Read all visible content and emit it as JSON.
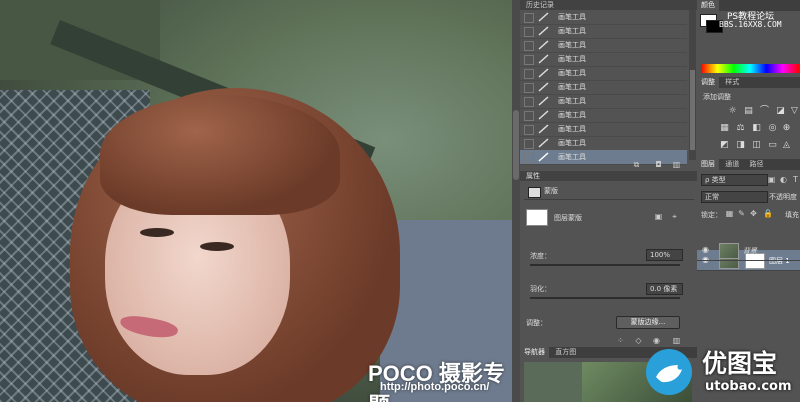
{
  "canvas": {
    "watermark_brand": "POCO 摄影专题",
    "watermark_url": "http://photo.poco.cn/"
  },
  "history_panel": {
    "title": "历史记录",
    "items": [
      "画笔工具",
      "画笔工具",
      "画笔工具",
      "画笔工具",
      "画笔工具",
      "画笔工具",
      "画笔工具",
      "画笔工具",
      "画笔工具",
      "画笔工具",
      "画笔工具"
    ]
  },
  "properties_panel": {
    "tab": "属性",
    "mask_type": "蒙版",
    "layer_mask_label": "图层蒙版",
    "density_label": "浓度：",
    "density_value": "100%",
    "feather_label": "羽化：",
    "feather_value": "0.0 像素",
    "refine_label": "调整：",
    "refine_button": "蒙版边缘..."
  },
  "navigator": {
    "tabs": [
      "导航器",
      "直方图"
    ]
  },
  "color_panel": {
    "tab": "颜色",
    "watermark": "PS教程论坛",
    "watermark_url": "BBS.16XX8.COM"
  },
  "adjustments_panel": {
    "tabs": [
      "调整",
      "样式"
    ],
    "add_label": "添加调整"
  },
  "layers_panel": {
    "tabs": [
      "图层",
      "通道",
      "路径"
    ],
    "filter_label": "ρ 类型",
    "blend_mode": "正常",
    "opacity_label": "不透明度",
    "lock_label": "锁定：",
    "fill_label": "填充",
    "layers": [
      {
        "name": "图层 1"
      },
      {
        "name": "背景"
      }
    ]
  },
  "site_logo": {
    "cn": "优图宝",
    "url": "utobao.com"
  },
  "colors": {
    "selection": "#6d7d8f",
    "logo_blue": "#2aa0db"
  }
}
